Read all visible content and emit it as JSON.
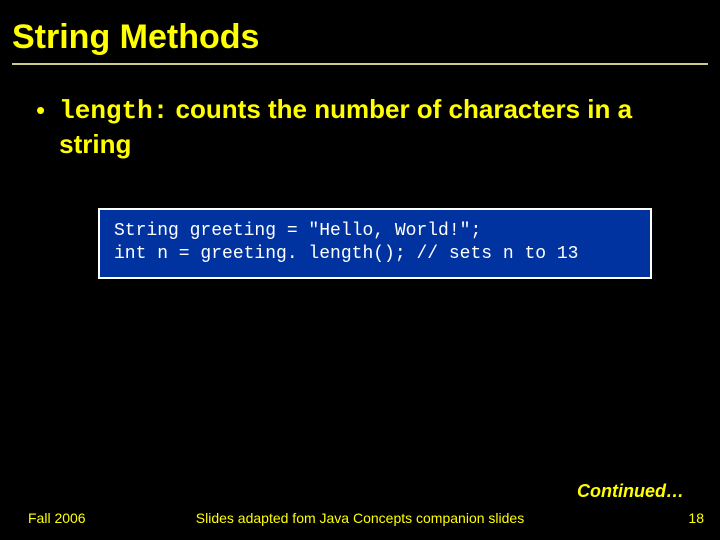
{
  "title": "String Methods",
  "bullet": {
    "dot": "•",
    "code": "length:",
    "rest": " counts the number of characters in a string"
  },
  "code_block": "String greeting = \"Hello, World!\";\nint n = greeting. length(); // sets n to 13",
  "continued": "Continued…",
  "footer": {
    "left": "Fall 2006",
    "center": "Slides adapted fom Java Concepts companion slides",
    "right": "18"
  }
}
